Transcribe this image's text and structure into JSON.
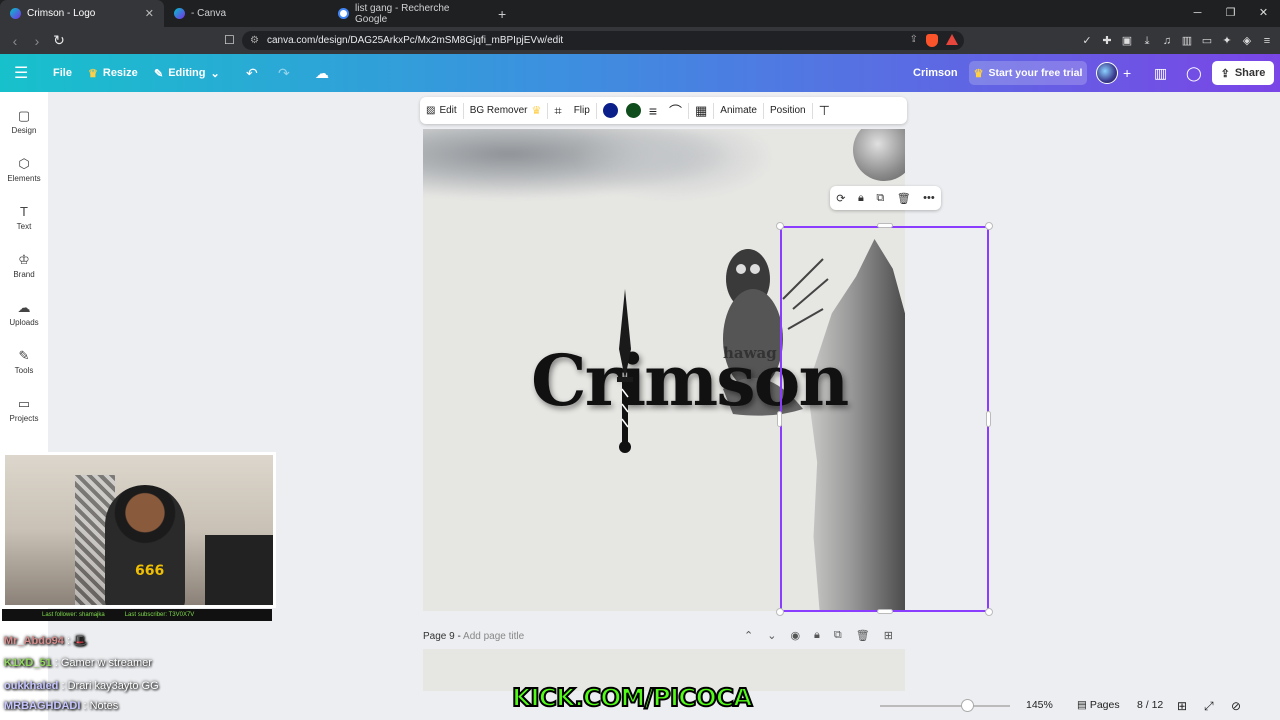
{
  "browser": {
    "tabs": [
      {
        "title": "Crimson - Logo",
        "active": true
      },
      {
        "title": "- Canva",
        "active": false
      },
      {
        "title": "list gang - Recherche Google",
        "active": false
      }
    ],
    "url": "canva.com/design/DAG25ArkxPc/Mx2mSM8Gjqfi_mBPIpjEVw/edit"
  },
  "header": {
    "file_label": "File",
    "resize_label": "Resize",
    "editing_label": "Editing",
    "design_title": "Crimson",
    "trial_label": "Start your free trial",
    "share_label": "Share"
  },
  "sidebar": {
    "items": [
      {
        "label": "Design",
        "icon": "design-icon"
      },
      {
        "label": "Elements",
        "icon": "elements-icon"
      },
      {
        "label": "Text",
        "icon": "text-icon"
      },
      {
        "label": "Brand",
        "icon": "brand-icon"
      },
      {
        "label": "Uploads",
        "icon": "uploads-icon"
      },
      {
        "label": "Tools",
        "icon": "tools-icon"
      },
      {
        "label": "Projects",
        "icon": "projects-icon"
      }
    ]
  },
  "toolbar": {
    "edit_label": "Edit",
    "bg_remover_label": "BG Remover",
    "flip_label": "Flip",
    "animate_label": "Animate",
    "position_label": "Position",
    "color_1": "#0b1f8a",
    "color_2": "#0f4d1c"
  },
  "canvas": {
    "logo_text": "Crimson",
    "sub_text": "hawag"
  },
  "page": {
    "label": "Page 9 -",
    "title_placeholder": "Add page title"
  },
  "footer": {
    "zoom": "145%",
    "zoom_fraction": 0.62,
    "pages_label": "Pages",
    "page_count": "8 / 12"
  },
  "stream": {
    "last_follower": "Last follower: shamajka",
    "last_subscriber": "Last subscriber: T3V0X7V",
    "chat": [
      {
        "user": "Mr_Abdo94",
        "message": ": 🎩"
      },
      {
        "user": "K1XD_51",
        "message": ": Gamer w streamer"
      },
      {
        "user": "oukkhaled",
        "message": ": Drari kay3ayto GG"
      },
      {
        "user": "MRBAGHDADI",
        "message": ": Notes"
      }
    ],
    "channel": "KICK.COM/PICOCA"
  }
}
